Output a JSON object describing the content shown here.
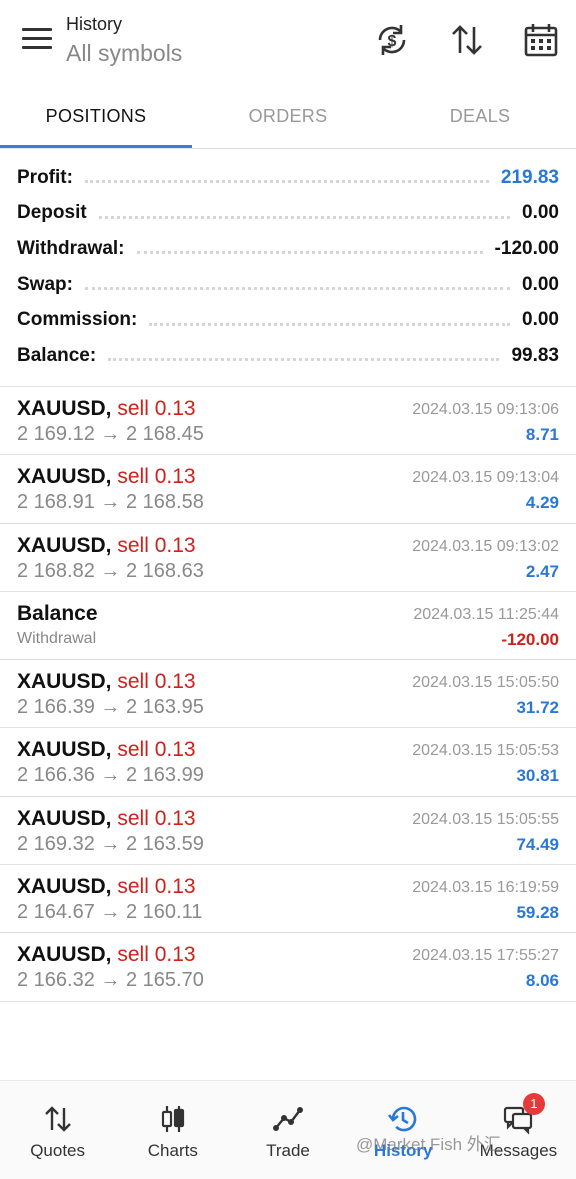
{
  "header": {
    "title": "History",
    "subtitle": "All symbols",
    "icons": [
      "sync-currency-icon",
      "sort-icon",
      "calendar-icon"
    ]
  },
  "tabs": [
    {
      "label": "POSITIONS",
      "active": true
    },
    {
      "label": "ORDERS",
      "active": false
    },
    {
      "label": "DEALS",
      "active": false
    }
  ],
  "summary": [
    {
      "label": "Profit:",
      "value": "219.83",
      "highlight": true
    },
    {
      "label": "Deposit",
      "value": "0.00",
      "highlight": false
    },
    {
      "label": "Withdrawal:",
      "value": "-120.00",
      "highlight": false
    },
    {
      "label": "Swap:",
      "value": "0.00",
      "highlight": false
    },
    {
      "label": "Commission:",
      "value": "0.00",
      "highlight": false
    },
    {
      "label": "Balance:",
      "value": "99.83",
      "highlight": false
    }
  ],
  "deals": [
    {
      "symbol": "XAUUSD,",
      "side": "sell 0.13",
      "prices": "2 169.12 → 2 168.45",
      "time": "2024.03.15 09:13:06",
      "profit": "8.71"
    },
    {
      "symbol": "XAUUSD,",
      "side": "sell 0.13",
      "prices": "2 168.91 → 2 168.58",
      "time": "2024.03.15 09:13:04",
      "profit": "4.29"
    },
    {
      "symbol": "XAUUSD,",
      "side": "sell 0.13",
      "prices": "2 168.82 → 2 168.63",
      "time": "2024.03.15 09:13:02",
      "profit": "2.47"
    },
    {
      "symbol": "Balance",
      "type": "Withdrawal",
      "time": "2024.03.15 11:25:44",
      "profit": "-120.00",
      "negative": true
    },
    {
      "symbol": "XAUUSD,",
      "side": "sell 0.13",
      "prices": "2 166.39 → 2 163.95",
      "time": "2024.03.15 15:05:50",
      "profit": "31.72"
    },
    {
      "symbol": "XAUUSD,",
      "side": "sell 0.13",
      "prices": "2 166.36 → 2 163.99",
      "time": "2024.03.15 15:05:53",
      "profit": "30.81"
    },
    {
      "symbol": "XAUUSD,",
      "side": "sell 0.13",
      "prices": "2 169.32 → 2 163.59",
      "time": "2024.03.15 15:05:55",
      "profit": "74.49"
    },
    {
      "symbol": "XAUUSD,",
      "side": "sell 0.13",
      "prices": "2 164.67 → 2 160.11",
      "time": "2024.03.15 16:19:59",
      "profit": "59.28"
    },
    {
      "symbol": "XAUUSD,",
      "side": "sell 0.13",
      "prices": "2 166.32 → 2 165.70",
      "time": "2024.03.15 17:55:27",
      "profit": "8.06"
    }
  ],
  "bottom_nav": [
    {
      "label": "Quotes",
      "icon": "quotes-icon",
      "active": false
    },
    {
      "label": "Charts",
      "icon": "candlestick-chart-icon",
      "active": false
    },
    {
      "label": "Trade",
      "icon": "trade-line-icon",
      "active": false
    },
    {
      "label": "History",
      "icon": "history-clock-icon",
      "active": true
    },
    {
      "label": "Messages",
      "icon": "messages-icon",
      "active": false,
      "badge": "1"
    }
  ],
  "watermark": "@Market Fish 外汇",
  "colors": {
    "accent": "#2a78d6",
    "sell": "#d0201a",
    "negative": "#d0201a",
    "badge": "#e43a3a"
  }
}
